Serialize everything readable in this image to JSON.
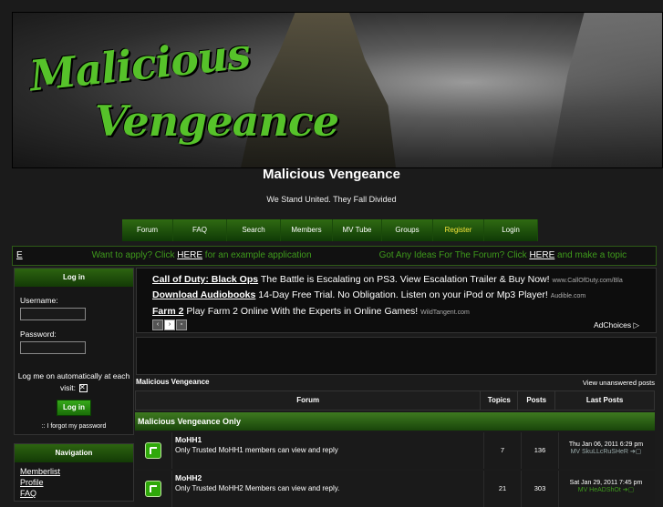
{
  "banner": {
    "logo_line1": "Malicious",
    "logo_line2": "Vengeance"
  },
  "site": {
    "title": "Malicious Vengeance",
    "description": "We Stand United. They Fall Divided"
  },
  "nav": [
    {
      "label": "Forum",
      "width": 55
    },
    {
      "label": "FAQ",
      "width": 58
    },
    {
      "label": "Search",
      "width": 58
    },
    {
      "label": "Members",
      "width": 56
    },
    {
      "label": "MV Tube",
      "width": 53
    },
    {
      "label": "Groups",
      "width": 55
    },
    {
      "label": "Register",
      "width": 55
    },
    {
      "label": "Login",
      "width": 58
    }
  ],
  "marquee": {
    "lead": "E",
    "apply_pre": "Want to apply? Click ",
    "apply_link": "HERE",
    "apply_post": " for an example application",
    "ideas_pre": "Got Any Ideas For The Forum? Click ",
    "ideas_link": "HERE",
    "ideas_post": " and make a topic"
  },
  "login": {
    "title": "Log in",
    "username_label": "Username:",
    "password_label": "Password:",
    "auto_label": "Log me on automatically at each visit:",
    "button": "Log in",
    "forgot": ":: I forgot my password"
  },
  "navigation": {
    "title": "Navigation",
    "links": [
      "Memberlist",
      "Profile",
      "FAQ"
    ]
  },
  "ads": [
    {
      "title": "Call of Duty: Black Ops",
      "text": " The Battle is Escalating on PS3. View Escalation Trailer & Buy Now! ",
      "source": "www.CallOfDuty.com/Bla"
    },
    {
      "title": "Download Audiobooks",
      "text": " 14-Day Free Trial. No Obligation. Listen on your iPod or Mp3 Player! ",
      "source": "Audible.com"
    },
    {
      "title": "Farm 2",
      "text": " Play Farm 2 Online With the Experts in Online Games! ",
      "source": "WildTangent.com"
    }
  ],
  "adchoices": "AdChoices ▷",
  "breadcrumb": "Malicious Vengeance",
  "unanswered": "View unanswered posts",
  "table": {
    "headers": {
      "forum": "Forum",
      "topics": "Topics",
      "posts": "Posts",
      "last": "Last Posts"
    },
    "category": "Malicious Vengeance Only",
    "rows": [
      {
        "name": "MoHH1",
        "desc": "Only Trusted MoHH1 members can view and reply",
        "topics": "7",
        "posts": "136",
        "date": "Thu Jan 06, 2011 6:29 pm",
        "by": "MV SkuLLcRuSHeR"
      },
      {
        "name": "MoHH2",
        "desc": "Only Trusted MoHH2 Members can view and reply.",
        "topics": "21",
        "posts": "303",
        "date": "Sat Jan 29, 2011 7:45 pm",
        "by": "MV HeADShOt"
      }
    ]
  },
  "colors": {
    "accent_green": "#3f9a1c",
    "nav_bg": "#1f5a0c",
    "register": "#f4e43a"
  }
}
